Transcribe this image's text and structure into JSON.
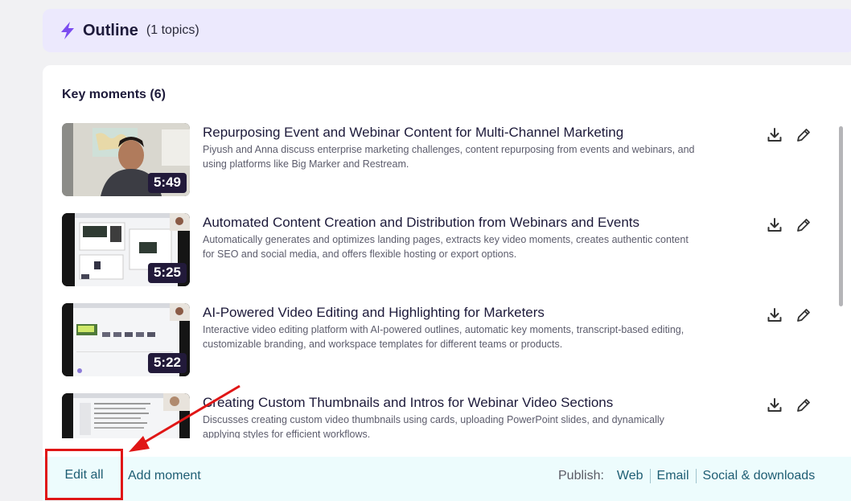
{
  "outline": {
    "title": "Outline",
    "count": "(1 topics)",
    "icon": "lightning-bolt-icon",
    "accent": "#7b4cf0"
  },
  "key_moments": {
    "title": "Key moments (6)",
    "items": [
      {
        "title": "Repurposing Event and Webinar Content for Multi-Channel Marketing",
        "description": "Piyush and Anna discuss enterprise marketing challenges, content repurposing from events and webinars, and using platforms like Big Marker and Restream.",
        "duration": "5:49"
      },
      {
        "title": "Automated Content Creation and Distribution from Webinars and Events",
        "description": "Automatically generates and optimizes landing pages, extracts key video moments, creates authentic content for SEO and social media, and offers flexible hosting or export options.",
        "duration": "5:25"
      },
      {
        "title": "AI-Powered Video Editing and Highlighting for Marketers",
        "description": "Interactive video editing platform with AI-powered outlines, automatic key moments, transcript-based editing, customizable branding, and workspace templates for different teams or products.",
        "duration": "5:22"
      },
      {
        "title": "Creating Custom Thumbnails and Intros for Webinar Video Sections",
        "description": "Discusses creating custom video thumbnails using cards, uploading PowerPoint slides, and dynamically applying styles for efficient workflows.",
        "duration": ""
      }
    ],
    "action_icons": [
      "download-icon",
      "pencil-icon"
    ]
  },
  "footer": {
    "edit_all": "Edit all",
    "add_moment": "Add moment",
    "publish_label": "Publish:",
    "publish_links": [
      "Web",
      "Email",
      "Social & downloads"
    ],
    "highlight_color": "#e01616"
  }
}
